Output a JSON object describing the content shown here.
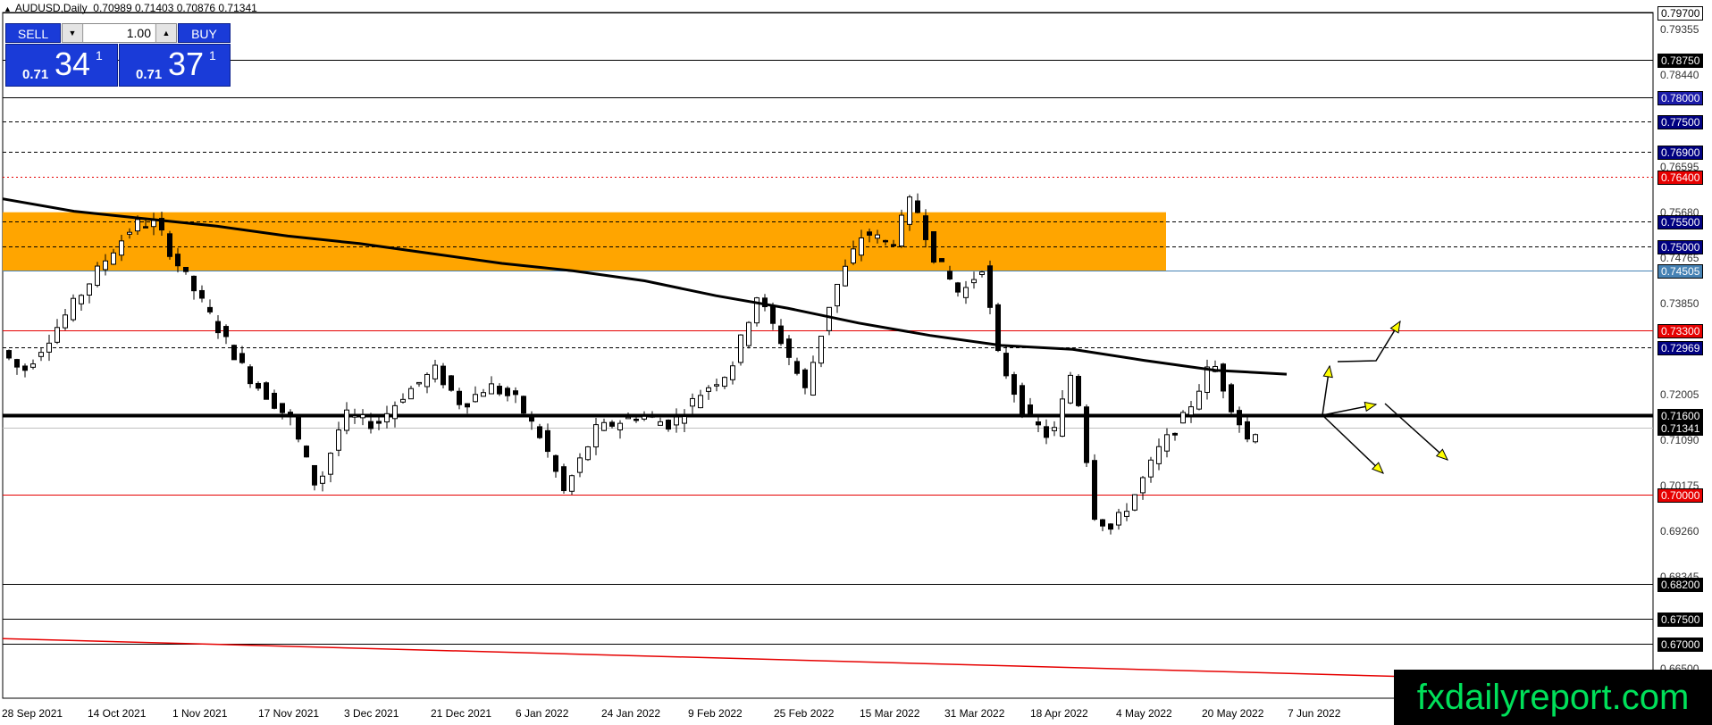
{
  "chart": {
    "symbol_title": "AUDUSD,Daily",
    "ohlc": "0.70989 0.71403 0.70876 0.71341",
    "watermark": "fxdailyreport.com"
  },
  "trade_panel": {
    "sell_label": "SELL",
    "buy_label": "BUY",
    "lot_value": "1.00",
    "sell_small": "0.71",
    "sell_big": "34",
    "sell_sup": "1",
    "buy_small": "0.71",
    "buy_big": "37",
    "buy_sup": "1"
  },
  "colors": {
    "zone": "#ffa500",
    "sell_button": "#1a3bd8",
    "red_line": "#e60000",
    "watermark_text": "#00e05a",
    "arrow_fill": "#ffff00"
  },
  "chart_data": {
    "type": "candlestick",
    "x_labels": [
      "28 Sep 2021",
      "14 Oct 2021",
      "1 Nov 2021",
      "17 Nov 2021",
      "3 Dec 2021",
      "21 Dec 2021",
      "6 Jan 2022",
      "24 Jan 2022",
      "9 Feb 2022",
      "25 Feb 2022",
      "15 Mar 2022",
      "31 Mar 2022",
      "18 Apr 2022",
      "4 May 2022",
      "20 May 2022",
      "7 Jun 2022"
    ],
    "y_range": [
      0.659,
      0.797
    ],
    "price_ticks": [
      "0.79355",
      "0.78440",
      "0.77525",
      "0.76595",
      "0.75680",
      "0.74765",
      "0.73850",
      "0.72935",
      "0.72005",
      "0.71090",
      "0.70175",
      "0.69260",
      "0.68345",
      "0.66500"
    ],
    "levels": [
      {
        "price": "0.79700",
        "style": "solid",
        "label_bg": "#ffffff",
        "label_fg": "#000000"
      },
      {
        "price": "0.78750",
        "style": "solid",
        "label_bg": "#000000",
        "label_fg": "#ffffff"
      },
      {
        "price": "0.78000",
        "style": "solid",
        "label_bg": "#1a1aa8",
        "label_fg": "#ffffff"
      },
      {
        "price": "0.77500",
        "style": "dashed",
        "label_bg": "#000080",
        "label_fg": "#ffffff"
      },
      {
        "price": "0.76900",
        "style": "dashed",
        "label_bg": "#000080",
        "label_fg": "#ffffff"
      },
      {
        "price": "0.76400",
        "style": "dotted-red",
        "label_bg": "#e60000",
        "label_fg": "#ffffff"
      },
      {
        "price": "0.75500",
        "style": "dashed",
        "label_bg": "#000080",
        "label_fg": "#ffffff"
      },
      {
        "price": "0.75000",
        "style": "dashed",
        "label_bg": "#000080",
        "label_fg": "#ffffff"
      },
      {
        "price": "0.74505",
        "style": "solid-blue",
        "label_bg": "#4682b4",
        "label_fg": "#ffffff"
      },
      {
        "price": "0.73300",
        "style": "solid-red",
        "label_bg": "#e60000",
        "label_fg": "#ffffff"
      },
      {
        "price": "0.72969",
        "style": "dashed",
        "label_bg": "#000080",
        "label_fg": "#ffffff"
      },
      {
        "price": "0.71600",
        "style": "thick",
        "label_bg": "#000000",
        "label_fg": "#ffffff"
      },
      {
        "price": "0.71341",
        "style": "bid",
        "label_bg": "#000000",
        "label_fg": "#ffffff"
      },
      {
        "price": "0.70000",
        "style": "solid-red",
        "label_bg": "#e60000",
        "label_fg": "#ffffff"
      },
      {
        "price": "0.68200",
        "style": "solid",
        "label_bg": "#000000",
        "label_fg": "#ffffff"
      },
      {
        "price": "0.67500",
        "style": "solid",
        "label_bg": "#000000",
        "label_fg": "#ffffff"
      },
      {
        "price": "0.67000",
        "style": "solid",
        "label_bg": "#000000",
        "label_fg": "#ffffff"
      }
    ],
    "zone": {
      "top": 0.7568,
      "bottom": 0.74505
    },
    "moving_average": [
      0.7595,
      0.757,
      0.7555,
      0.754,
      0.752,
      0.7505,
      0.7485,
      0.7465,
      0.745,
      0.743,
      0.74,
      0.7375,
      0.7345,
      0.732,
      0.73,
      0.7292,
      0.727,
      0.725,
      0.7242
    ],
    "trendline_red": [
      0.671,
      0.662
    ]
  }
}
